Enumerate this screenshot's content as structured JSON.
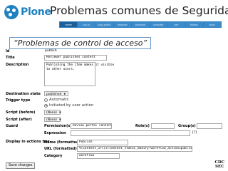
{
  "header": {
    "logo_text": "Plone",
    "slide_title": "Problemas comunes de Seguridad"
  },
  "navbar": {
    "tabs": [
      "home",
      "nav-sr",
      "blog-public",
      "modules",
      "personal",
      "calendar",
      "site",
      "folders",
      "skips"
    ]
  },
  "form": {
    "heading": "“Problemas de control de acceso”",
    "id": {
      "label": "Id",
      "value": "publish"
    },
    "title": {
      "label": "Title",
      "value": "Reviewer publishes content"
    },
    "description": {
      "label": "Description",
      "value": "Publishing the item makes it visible\nto other users."
    },
    "destination_state": {
      "label": "Destination state",
      "value": "published"
    },
    "trigger_type": {
      "label": "Trigger type",
      "options": [
        "Automatic",
        "Initiated by user action"
      ],
      "selected": 1
    },
    "script_before": {
      "label": "Script (before)",
      "value": "(None)"
    },
    "script_after": {
      "label": "Script (after)",
      "value": "(None)"
    },
    "guard": {
      "label": "Guard",
      "permissions_label": "Permission(s)",
      "permissions_value": "Review portal content",
      "roles_label": "Role(s)",
      "roles_value": "",
      "groups_label": "Group(s)",
      "groups_value": "",
      "expression_label": "Expression",
      "expression_value": "",
      "help_mark": "[?]"
    },
    "display_actions": {
      "label": "Display in actions box",
      "name_label": "Name (formatted)",
      "name_value": "Publish",
      "url_label": "URL (formatted)",
      "url_value": "%(content_url)s/content_status_modify?workflow_action=publish",
      "category_label": "Category",
      "category_value": "workflow"
    },
    "save_button": "Save changes"
  },
  "footer_logo": {
    "line1": "CDC",
    "line2": "SEC"
  }
}
